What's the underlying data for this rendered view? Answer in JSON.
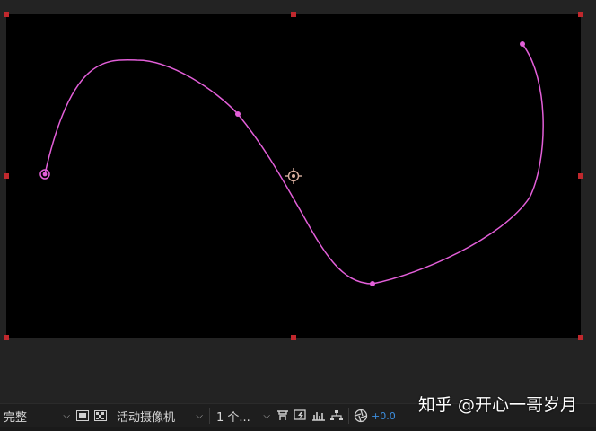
{
  "viewer": {
    "background": "#000000",
    "frame_color": "#232323",
    "path_color": "#e35fd9",
    "handle_color": "#c0282d"
  },
  "toolbar": {
    "resolution": {
      "value": "完整"
    },
    "camera": {
      "value": "活动摄像机"
    },
    "views": {
      "value": "1 个..."
    },
    "exposure": "+0.0",
    "icons": {
      "region": "region-of-interest-icon",
      "transparency": "transparency-grid-icon",
      "reset_view": "reset-view-icon",
      "fast_preview": "fast-preview-icon",
      "timeline": "timeline-icon",
      "flowchart": "flowchart-icon",
      "exposure_reset": "exposure-reset-icon"
    }
  },
  "watermark": "知乎 @开心一哥岁月"
}
